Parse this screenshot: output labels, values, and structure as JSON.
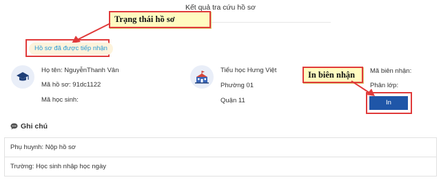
{
  "page_title": "Kết quả tra cứu hồ sơ",
  "status_badge": "Hồ sơ đã được tiếp nhận",
  "annotations": {
    "status_callout": "Trạng thái hồ sơ",
    "print_callout": "In biên nhận"
  },
  "student": {
    "icon": "graduation-cap-icon",
    "name": "Họ tên: NguyễnThanh Vân",
    "file_code": "Mã hồ sơ: 91dc1122",
    "student_code": "Mã học sinh:"
  },
  "school": {
    "icon": "school-building-icon",
    "name": "Tiểu học Hưng Việt",
    "ward": "Phường 01",
    "district": "Quận 11"
  },
  "receipt": {
    "receipt_code": "Mã biên nhận:",
    "class_assignment": "Phân lớp:",
    "print_button": "In"
  },
  "notes": {
    "icon": "chat-bubble-icon",
    "title": "Ghi chú",
    "rows": [
      {
        "label": "Phụ huynh:",
        "text": " Nộp hồ sơ"
      },
      {
        "label": "Trường:",
        "text": " Học sinh nhập học ngày"
      }
    ]
  },
  "colors": {
    "accent": "#1f56a8",
    "badge_text": "#2a9bd6",
    "badge_bg": "#fdf3dc",
    "annotation_border": "#e03a3a",
    "annotation_bg": "#fffbc0"
  }
}
